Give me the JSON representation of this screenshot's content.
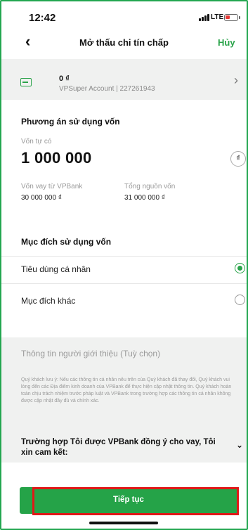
{
  "status_bar": {
    "time": "12:42",
    "network": "LTE"
  },
  "nav": {
    "back_icon": "chevron-left-icon",
    "title": "Mở thấu chi tín chấp",
    "cancel_label": "Hủy"
  },
  "account": {
    "amount": "0 ₫",
    "account_name": "VPSuper Account",
    "account_number": "227261943",
    "subtitle": "VPSuper Account | 227261943"
  },
  "capital_plan": {
    "title": "Phương án sử dụng vốn",
    "own_capital_label": "Vốn tự có",
    "own_capital_value": "1 000 000",
    "currency_symbol": "₫",
    "loan_label": "Vốn vay từ VPBank",
    "loan_value": "30 000 000 ₫",
    "total_label": "Tổng nguồn vốn",
    "total_value": "31 000 000 ₫"
  },
  "purpose": {
    "title": "Mục đích sử dụng vốn",
    "options": [
      {
        "label": "Tiêu dùng cá nhân",
        "selected": true
      },
      {
        "label": "Mục đích khác",
        "selected": false
      }
    ]
  },
  "referral": {
    "placeholder": "Thông tin người giới thiệu (Tuỳ chọn)",
    "note": "Quý khách lưu ý: Nếu các thông tin cá nhân nêu trên của Quý khách đã thay đổi, Quý khách vui lòng đến các Địa điểm kinh doanh của VPBank để thực hiện cập nhật thông tin. Quý khách hoàn toàn chịu trách nhiệm trước pháp luật và VPBank trong trường hợp các thông tin cá nhân không được cập nhật đầy đủ và chính xác."
  },
  "commitment": {
    "text": "Trường hợp Tôi được VPBank đồng ý cho vay, Tôi xin cam kết:"
  },
  "cta": {
    "label": "Tiếp tục"
  },
  "colors": {
    "brand_green": "#25a348",
    "highlight_red": "#e01818",
    "section_gray": "#f0f1f0"
  }
}
